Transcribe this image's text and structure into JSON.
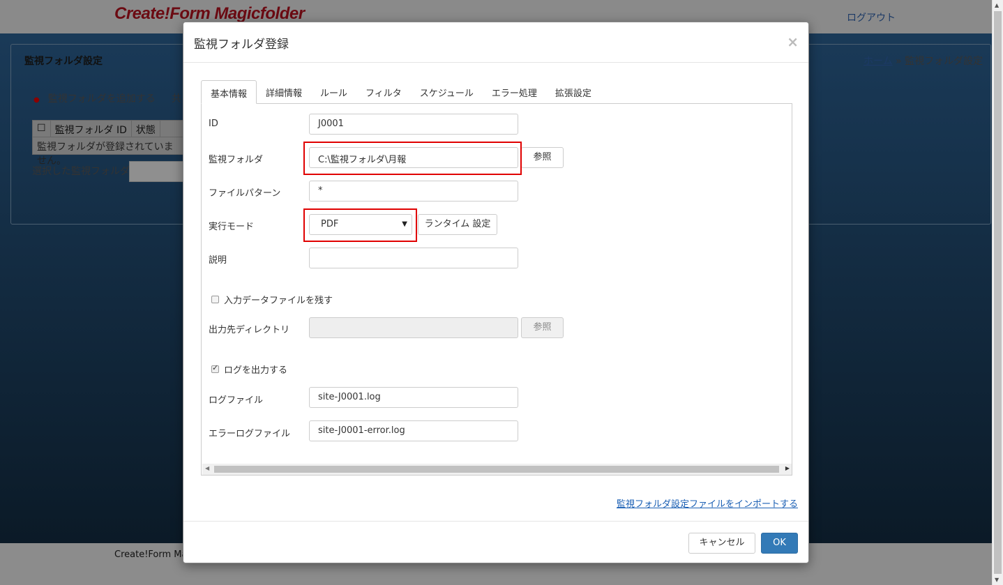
{
  "background": {
    "brand": "Create!Form Magicfolder",
    "logout": "ログアウト",
    "panel_title": "監視フォルダ設定",
    "breadcrumb": {
      "home": "ホーム",
      "sep": "»",
      "current": "監視フォルダ設定"
    },
    "add_folder": "監視フォルダを追加する",
    "share_partial": "共",
    "table": {
      "col_id": "監視フォルダ ID",
      "col_status": "状態",
      "empty": "監視フォルダが登録されていません。"
    },
    "selected_label": "選択した監視フォルダを",
    "footer": "Create!Form Mag"
  },
  "modal": {
    "title": "監視フォルダ登録",
    "close": "×",
    "tabs": [
      "基本情報",
      "詳細情報",
      "ルール",
      "フィルタ",
      "スケジュール",
      "エラー処理",
      "拡張設定"
    ],
    "form": {
      "id_label": "ID",
      "id_value": "J0001",
      "folder_label": "監視フォルダ",
      "folder_value": "C:\\監視フォルダ\\月報",
      "browse": "参照",
      "pattern_label": "ファイルパターン",
      "pattern_value": "*",
      "mode_label": "実行モード",
      "mode_value": "PDF",
      "runtime_button": "ランタイム 設定",
      "desc_label": "説明",
      "desc_value": "",
      "keep_input_label": "入力データファイルを残す",
      "output_dir_label": "出力先ディレクトリ",
      "output_dir_value": "",
      "output_browse": "参照",
      "log_output_label": "ログを出力する",
      "log_file_label": "ログファイル",
      "log_file_value": "site-J0001.log",
      "error_log_label": "エラーログファイル",
      "error_log_value": "site-J0001-error.log"
    },
    "import_link": "監視フォルダ設定ファイルをインポートする",
    "cancel": "キャンセル",
    "ok": "OK"
  }
}
